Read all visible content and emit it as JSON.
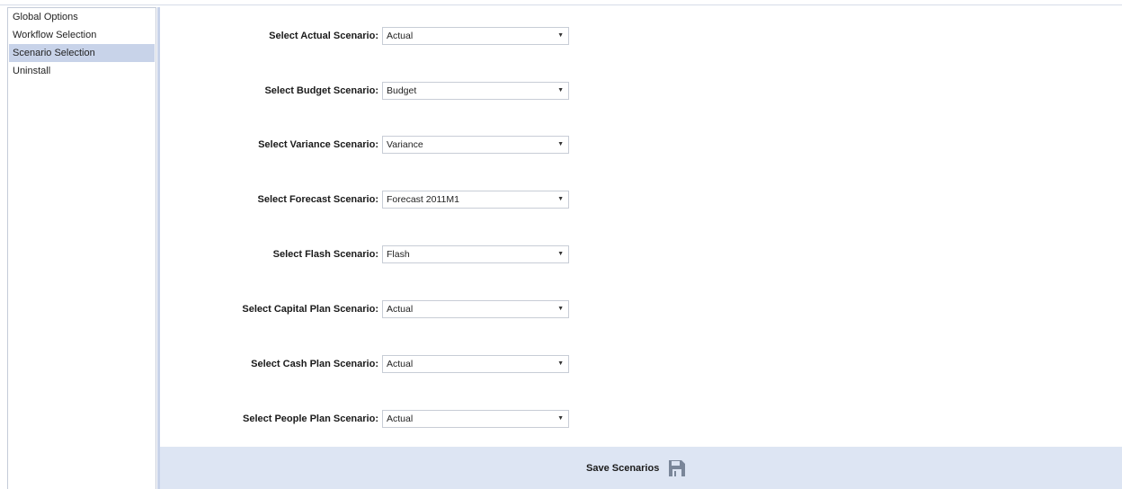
{
  "sidebar": {
    "items": [
      {
        "label": "Global Options"
      },
      {
        "label": "Workflow Selection"
      },
      {
        "label": "Scenario Selection"
      },
      {
        "label": "Uninstall"
      }
    ],
    "active_item": "Scenario Selection"
  },
  "form": {
    "rows": [
      {
        "label": "Select Actual Scenario:",
        "value": "Actual"
      },
      {
        "label": "Select Budget Scenario:",
        "value": "Budget"
      },
      {
        "label": "Select Variance Scenario:",
        "value": "Variance"
      },
      {
        "label": "Select Forecast Scenario:",
        "value": "Forecast 2011M1"
      },
      {
        "label": "Select Flash Scenario:",
        "value": "Flash"
      },
      {
        "label": "Select Capital Plan Scenario:",
        "value": "Actual"
      },
      {
        "label": "Select Cash Plan Scenario:",
        "value": "Actual"
      },
      {
        "label": "Select People Plan Scenario:",
        "value": "Actual"
      }
    ]
  },
  "footer": {
    "save_label": "Save Scenarios",
    "save_icon": "floppy-disk-icon"
  },
  "colors": {
    "active_item_bg": "#c8d3e9",
    "footer_bg": "#dde5f3",
    "icon_color": "#7a8699"
  }
}
